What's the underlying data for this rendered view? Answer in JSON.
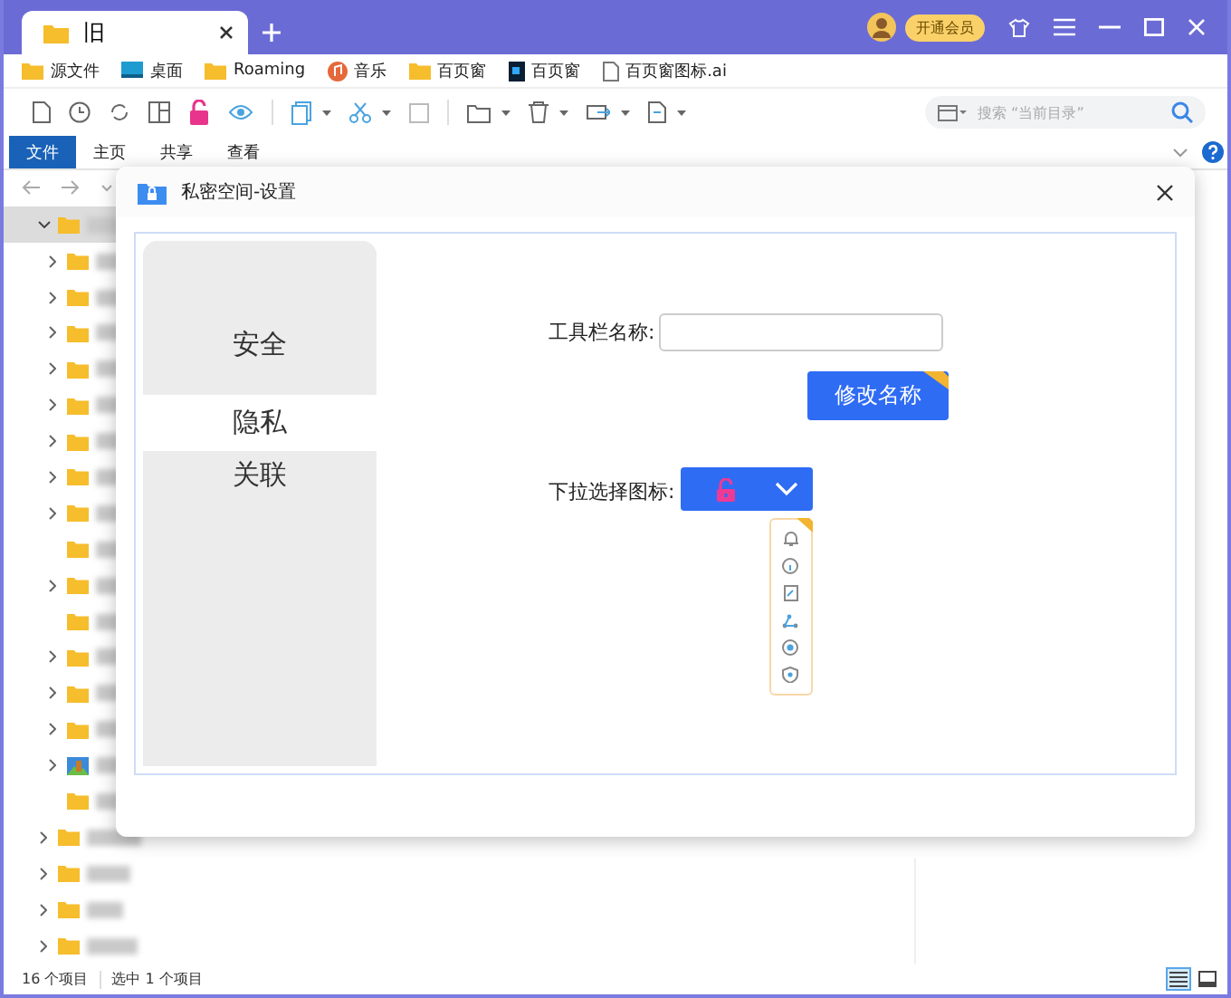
{
  "window": {
    "tab_title": "旧",
    "member_badge": "开通会员"
  },
  "bookmarks": [
    {
      "kind": "folder",
      "label": "源文件"
    },
    {
      "kind": "desktop",
      "label": "桌面"
    },
    {
      "kind": "folder",
      "label": "Roaming"
    },
    {
      "kind": "music",
      "label": "音乐"
    },
    {
      "kind": "folder",
      "label": "百页窗"
    },
    {
      "kind": "ps",
      "label": "百页窗"
    },
    {
      "kind": "file",
      "label": "百页窗图标.ai"
    }
  ],
  "search": {
    "placeholder": "搜索 “当前目录”"
  },
  "ribbon_tabs": [
    {
      "label": "文件",
      "selected": true
    },
    {
      "label": "主页",
      "selected": false
    },
    {
      "label": "共享",
      "selected": false
    },
    {
      "label": "查看",
      "selected": false
    }
  ],
  "tree": [
    {
      "kind": "folder",
      "expandable": true,
      "expanded": true,
      "selected": true,
      "children": [
        {
          "kind": "folder",
          "expandable": true
        },
        {
          "kind": "folder",
          "expandable": true
        },
        {
          "kind": "folder",
          "expandable": true
        },
        {
          "kind": "folder",
          "expandable": true
        },
        {
          "kind": "folder",
          "expandable": true
        },
        {
          "kind": "folder",
          "expandable": true
        },
        {
          "kind": "folder",
          "expandable": true
        },
        {
          "kind": "folder",
          "expandable": true
        },
        {
          "kind": "folder",
          "expandable": false
        },
        {
          "kind": "folder",
          "expandable": true
        },
        {
          "kind": "folder",
          "expandable": false
        },
        {
          "kind": "folder",
          "expandable": true
        },
        {
          "kind": "folder",
          "expandable": true
        },
        {
          "kind": "folder",
          "expandable": true
        },
        {
          "kind": "image",
          "expandable": true
        },
        {
          "kind": "folder",
          "expandable": false
        }
      ]
    },
    {
      "kind": "folder",
      "expandable": true,
      "expanded": false,
      "selected": false
    },
    {
      "kind": "folder",
      "expandable": true,
      "expanded": false,
      "selected": false
    },
    {
      "kind": "folder",
      "expandable": true,
      "expanded": false,
      "selected": false
    },
    {
      "kind": "folder",
      "expandable": true,
      "expanded": false,
      "selected": false
    }
  ],
  "status_bar": {
    "item_count": "16 个项目",
    "selection": "选中 1 个项目"
  },
  "view_buttons": [
    {
      "kind": "details",
      "selected": true
    },
    {
      "kind": "tiles",
      "selected": false
    }
  ],
  "dialog": {
    "title": "私密空间-设置",
    "nav": [
      {
        "label": "安全",
        "selected": false
      },
      {
        "label": "隐私",
        "selected": true
      },
      {
        "label": "关联",
        "selected": false
      }
    ],
    "name_label": "工具栏名称:",
    "rename_button": "修改名称",
    "icon_label": "下拉选择图标:",
    "icon_dropdown": {
      "expanded": true
    }
  }
}
